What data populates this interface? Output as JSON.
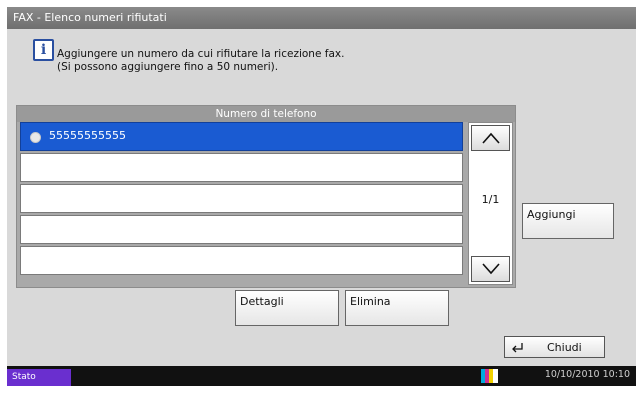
{
  "window": {
    "title": "FAX - Elenco numeri rifiutati"
  },
  "info": {
    "icon": "info-icon",
    "line1": "Aggiungere un numero da cui rifiutare la ricezione fax.",
    "line2": "(Si possono aggiungere fino a 50 numeri)."
  },
  "list": {
    "header": "Numero di telefono",
    "rows": [
      {
        "number": "55555555555",
        "selected": true,
        "icon": "phone-icon"
      },
      {
        "number": ""
      },
      {
        "number": ""
      },
      {
        "number": ""
      },
      {
        "number": ""
      }
    ],
    "page_indicator": "1/1"
  },
  "buttons": {
    "add": "Aggiungi",
    "details": "Dettagli",
    "delete": "Elimina",
    "close": "Chiudi"
  },
  "status": {
    "label": "Stato",
    "datetime": "10/10/2010  10:10"
  },
  "colors": {
    "selection": "#1a5bd2",
    "status_badge": "#6a2fcf"
  }
}
